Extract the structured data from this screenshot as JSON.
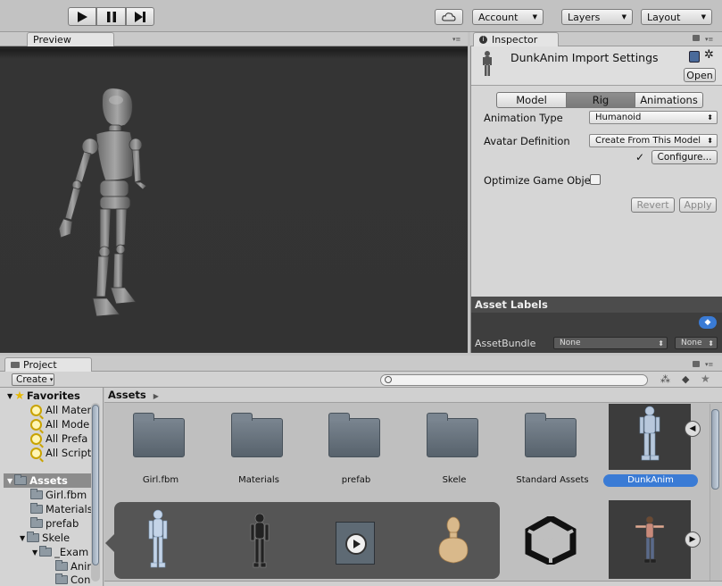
{
  "toolbar": {
    "play_icon": "play-icon",
    "pause_icon": "pause-icon",
    "step_icon": "step-icon",
    "cloud_icon": "cloud-icon",
    "account": "Account",
    "layers": "Layers",
    "layout": "Layout"
  },
  "preview": {
    "tab": "Preview"
  },
  "inspector": {
    "tab": "Inspector",
    "title": "DunkAnim Import Settings",
    "open_button": "Open",
    "tabs": [
      "Model",
      "Rig",
      "Animations"
    ],
    "active_tab": "Rig",
    "animation_type_label": "Animation Type",
    "animation_type_value": "Humanoid",
    "avatar_definition_label": "Avatar Definition",
    "avatar_definition_value": "Create From This Model",
    "checkmark": "✓",
    "configure_button": "Configure...",
    "optimize_label": "Optimize Game Obje",
    "revert_button": "Revert",
    "apply_button": "Apply",
    "asset_labels": "Asset Labels",
    "assetbundle_label": "AssetBundle",
    "assetbundle_value": "None",
    "assetbundle_variant": "None"
  },
  "project": {
    "tab": "Project",
    "create": "Create",
    "search_placeholder": "",
    "favorites_label": "Favorites",
    "favorites": [
      "All Mater",
      "All Mode",
      "All Prefa",
      "All Script"
    ],
    "assets_label": "Assets",
    "tree": [
      "Girl.fbm",
      "Materials",
      "prefab",
      "Skele",
      "_Exam",
      "Anir",
      "Con"
    ],
    "breadcrumb": "Assets",
    "grid_items": [
      "Girl.fbm",
      "Materials",
      "prefab",
      "Skele",
      "Standard Assets",
      "DunkAnim"
    ],
    "accent": "#3a7bd5"
  }
}
